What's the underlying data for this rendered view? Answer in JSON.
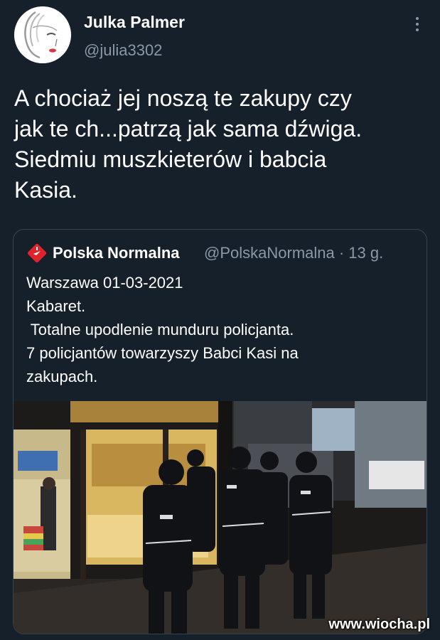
{
  "author": {
    "name": "Julka Palmer",
    "handle": "@julia3302"
  },
  "tweet": {
    "lines": [
      "A chociaż jej noszą te zakupy czy",
      "jak te ch...patrzą jak sama dźwiga.",
      "Siedmiu muszkieterów i babcia",
      "Kasia."
    ]
  },
  "quoted": {
    "name": "Polska Normalna",
    "handle_time": "@PolskaNormalna · 13 g.",
    "lines": [
      "Warszawa 01-03-2021",
      "Kabaret.",
      " Totalne upodlenie munduru policjanta.",
      "7 policjantów towarzyszy Babci Kasi na",
      "zakupach."
    ]
  },
  "watermark": "www.wiocha.pl",
  "colors": {
    "background": "#15202b",
    "secondary_text": "#8b98a5",
    "border": "#38444d",
    "logo_red": "#e0222b"
  },
  "icons": [
    "more-vertical-icon",
    "polska-normalna-logo-icon"
  ]
}
